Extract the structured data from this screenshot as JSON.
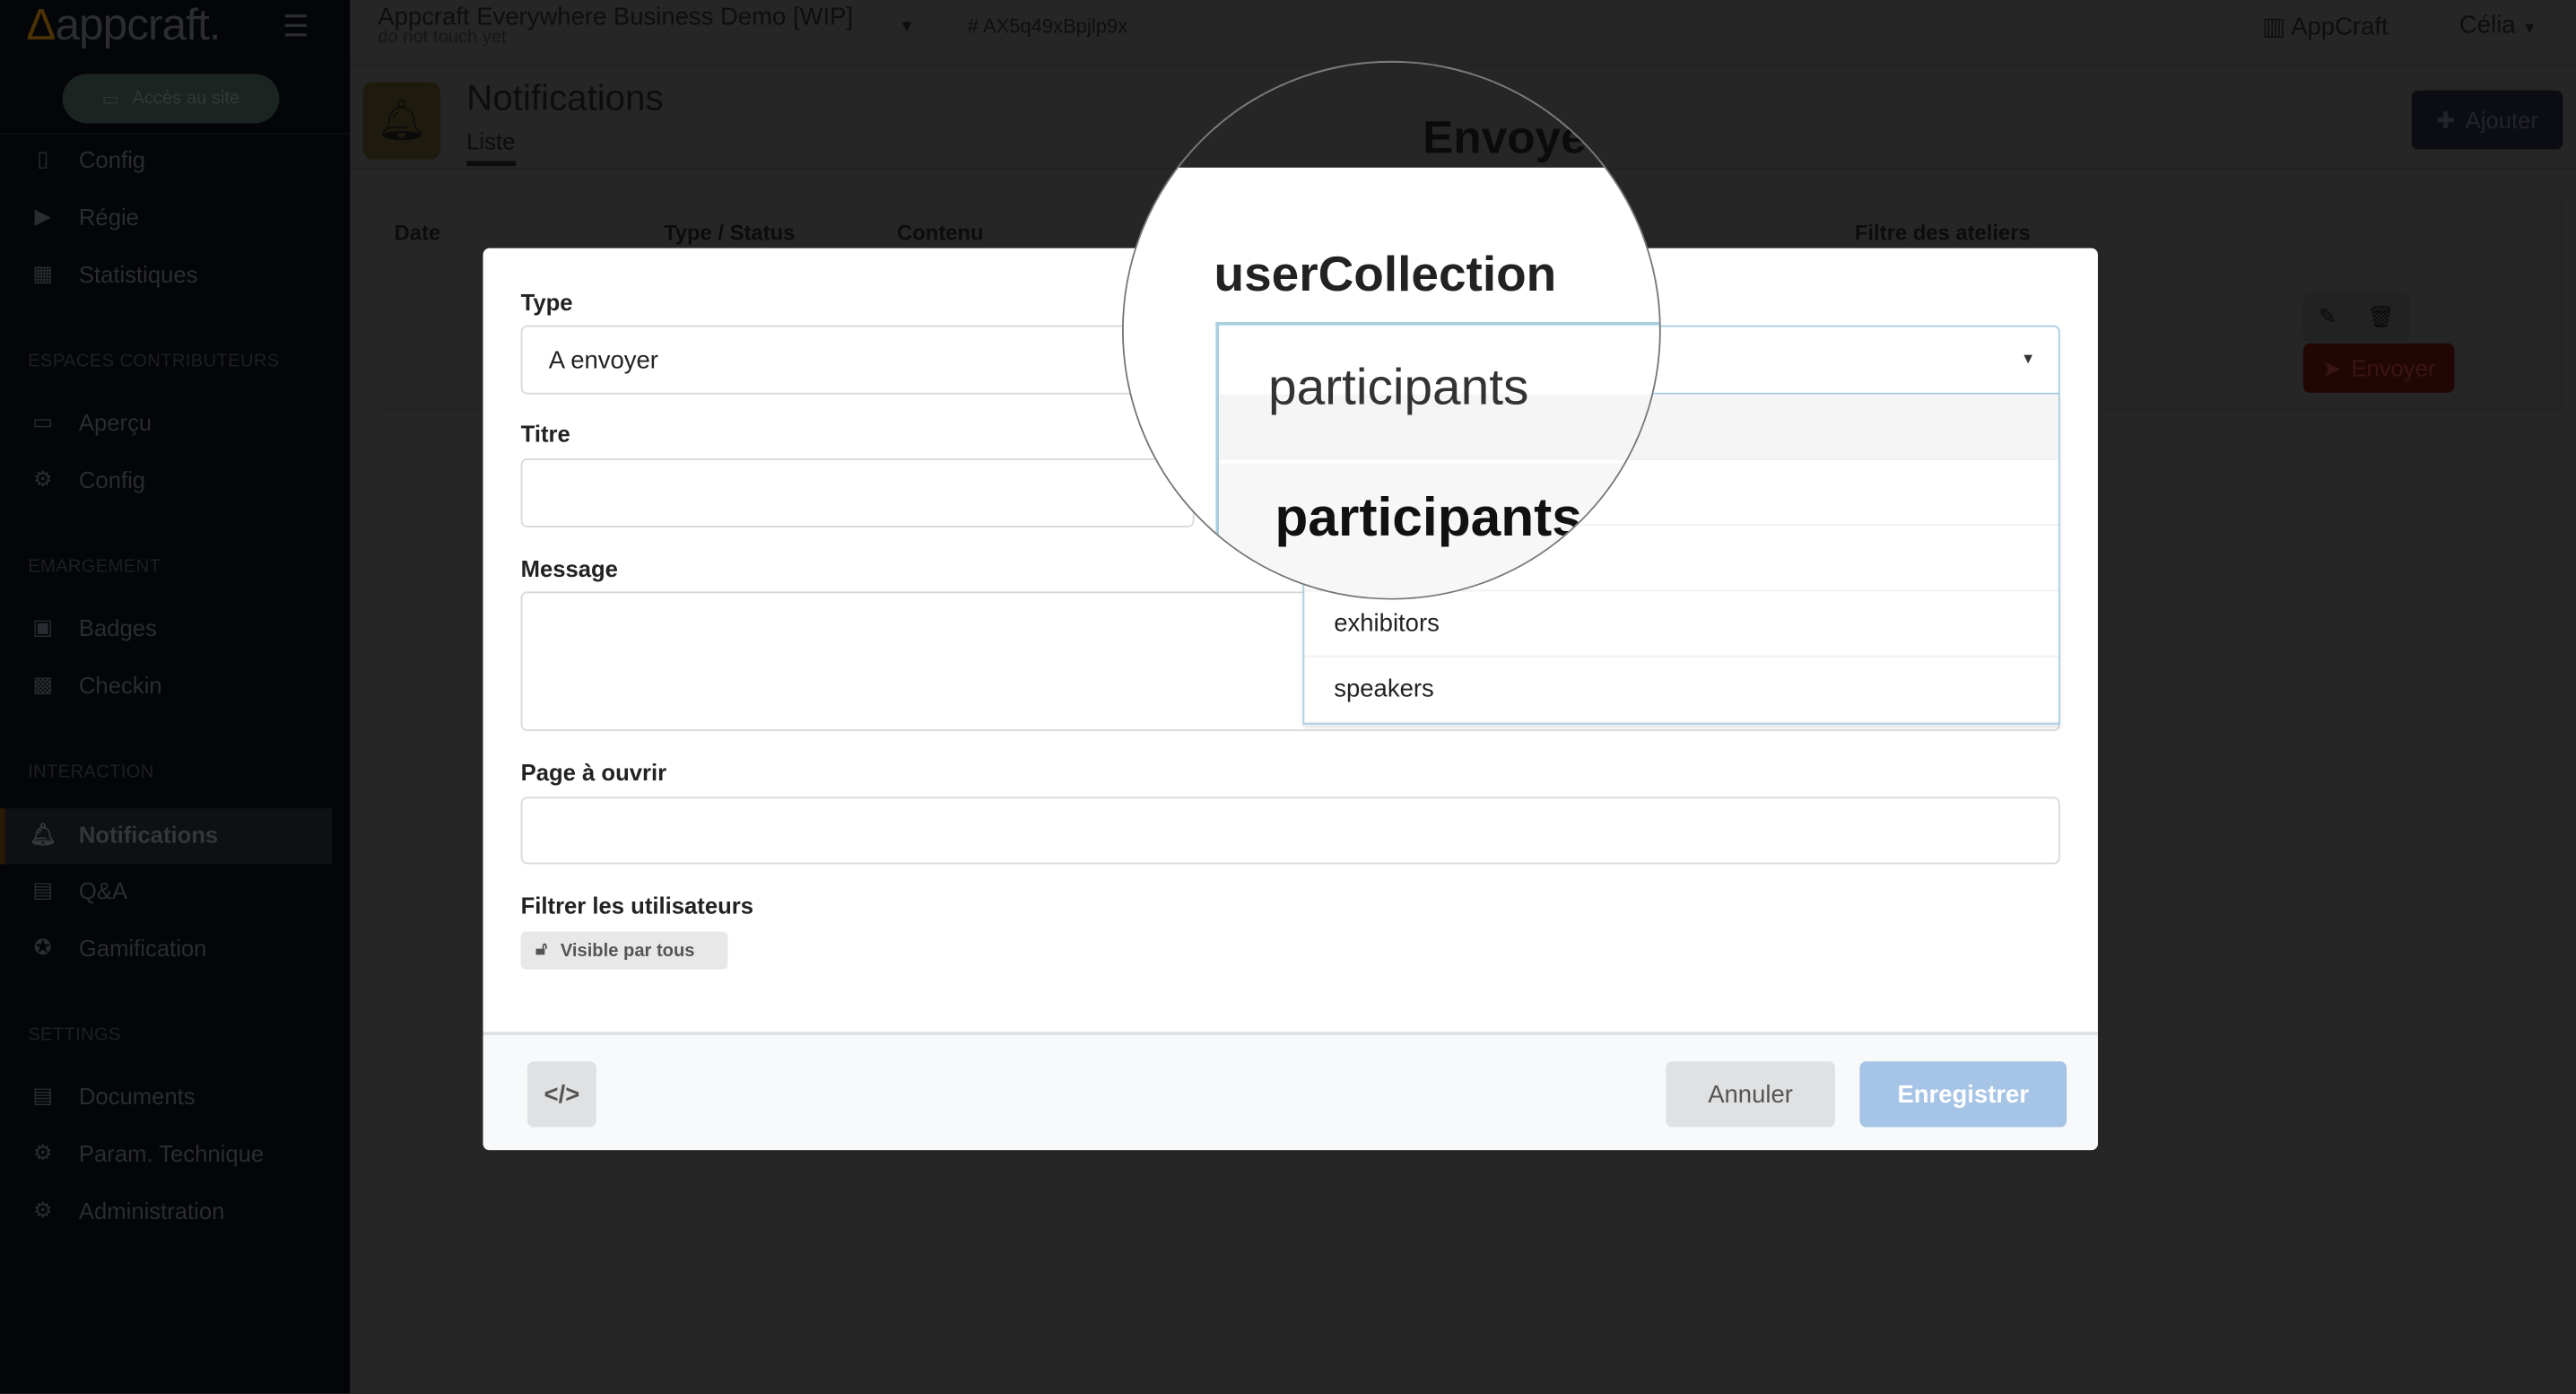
{
  "sidebar": {
    "logo": "appcraft.",
    "access_button": "Accès au site",
    "items": [
      {
        "label": "Config",
        "icon": "mobile-gear-icon"
      },
      {
        "label": "Régie",
        "icon": "screen-gear-icon"
      },
      {
        "label": "Statistiques",
        "icon": "grid-icon"
      }
    ],
    "sections": [
      {
        "title": "ESPACES CONTRIBUTEURS",
        "items": [
          {
            "label": "Aperçu",
            "icon": "laptop-icon"
          },
          {
            "label": "Config",
            "icon": "gear-square-icon"
          }
        ]
      },
      {
        "title": "EMARGEMENT",
        "items": [
          {
            "label": "Badges",
            "icon": "badge-icon"
          },
          {
            "label": "Checkin",
            "icon": "qrcode-icon"
          }
        ]
      },
      {
        "title": "INTERACTION",
        "items": [
          {
            "label": "Notifications",
            "icon": "bell-icon",
            "active": true
          },
          {
            "label": "Q&A",
            "icon": "chat-icon"
          },
          {
            "label": "Gamification",
            "icon": "star-icon"
          }
        ]
      },
      {
        "title": "SETTINGS",
        "items": [
          {
            "label": "Documents",
            "icon": "files-icon"
          },
          {
            "label": "Param. Technique",
            "icon": "gear-square-icon"
          },
          {
            "label": "Administration",
            "icon": "gear-icon"
          }
        ]
      }
    ]
  },
  "topbar": {
    "app_title": "Appcraft Everywhere Business Demo [WIP]",
    "app_subtitle": "do not touch yet",
    "app_id": "# AX5q49xBpjlp9x",
    "org": "AppCraft",
    "user": "Célia"
  },
  "page": {
    "title": "Notifications",
    "tab": "Liste",
    "add_button": "Ajouter",
    "columns": [
      "Date",
      "Type / Status",
      "Contenu",
      "Filtre des ateliers"
    ],
    "send_button": "Envoyer"
  },
  "modal": {
    "type_label": "Type",
    "type_value": "A envoyer",
    "title_label": "Titre",
    "title_value": "",
    "message_label": "Message",
    "message_value": "",
    "page_label": "Page à ouvrir",
    "page_value": "",
    "filter_label": "Filtrer les utilisateurs",
    "visibility_chip": "Visible par tous",
    "user_collection_label": "userCollection",
    "user_collection_value": "participants",
    "options": [
      "participants",
      "exhibitors",
      "speakers"
    ],
    "cancel_button": "Annuler",
    "save_button": "Enregistrer"
  },
  "magnifier": {
    "background_text": "Envoye"
  },
  "colors": {
    "primary_disabled": "#a6c4e6",
    "select_border": "#a9cfe0"
  }
}
